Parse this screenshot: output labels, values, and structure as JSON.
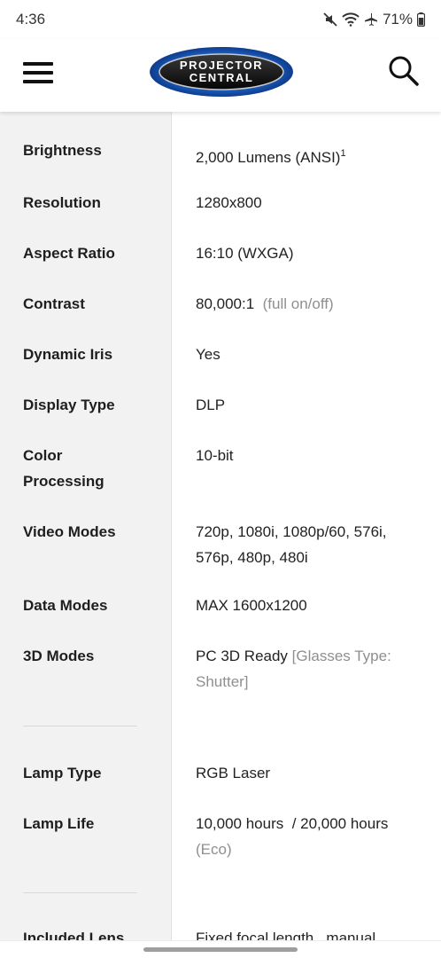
{
  "status_bar": {
    "time": "4:36",
    "battery": "71%",
    "icons": [
      "mute-icon",
      "wifi-icon",
      "airplane-icon",
      "battery-icon"
    ]
  },
  "header": {
    "logo_line1": "PROJECTOR",
    "logo_line2": "CENTRAL",
    "menu_icon": "hamburger-menu-icon",
    "search_icon": "search-icon"
  },
  "specs": [
    {
      "label": "Brightness",
      "value": "2,000 Lumens (ANSI)",
      "sup": "1"
    },
    {
      "label": "Resolution",
      "value": "1280x800"
    },
    {
      "label": "Aspect Ratio",
      "value": "16:10 (WXGA)"
    },
    {
      "label": "Contrast",
      "value": "80,000:1",
      "note": "(full on/off)"
    },
    {
      "label": "Dynamic Iris",
      "value": "Yes"
    },
    {
      "label": "Display Type",
      "value": "DLP"
    },
    {
      "label": "Color Processing",
      "value": "10-bit"
    },
    {
      "label": "Video Modes",
      "value": "720p, 1080i, 1080p/60, 576i, 576p, 480p, 480i"
    },
    {
      "label": "Data Modes",
      "value": "MAX 1600x1200"
    },
    {
      "label": "3D Modes",
      "value": "PC 3D Ready",
      "note": "[Glasses Type: Shutter]"
    },
    {
      "label": "Lamp Type",
      "value": "RGB Laser"
    },
    {
      "label": "Lamp Life",
      "value": "10,000 hours  / 20,000 hours",
      "note": "(Eco)"
    },
    {
      "label": "Included Lens",
      "value": "Fixed focal length , manual"
    }
  ],
  "colors": {
    "label_column_bg": "#f2f2f2",
    "muted_text": "#8f8f8f",
    "logo_blue": "#1e6fd8"
  }
}
